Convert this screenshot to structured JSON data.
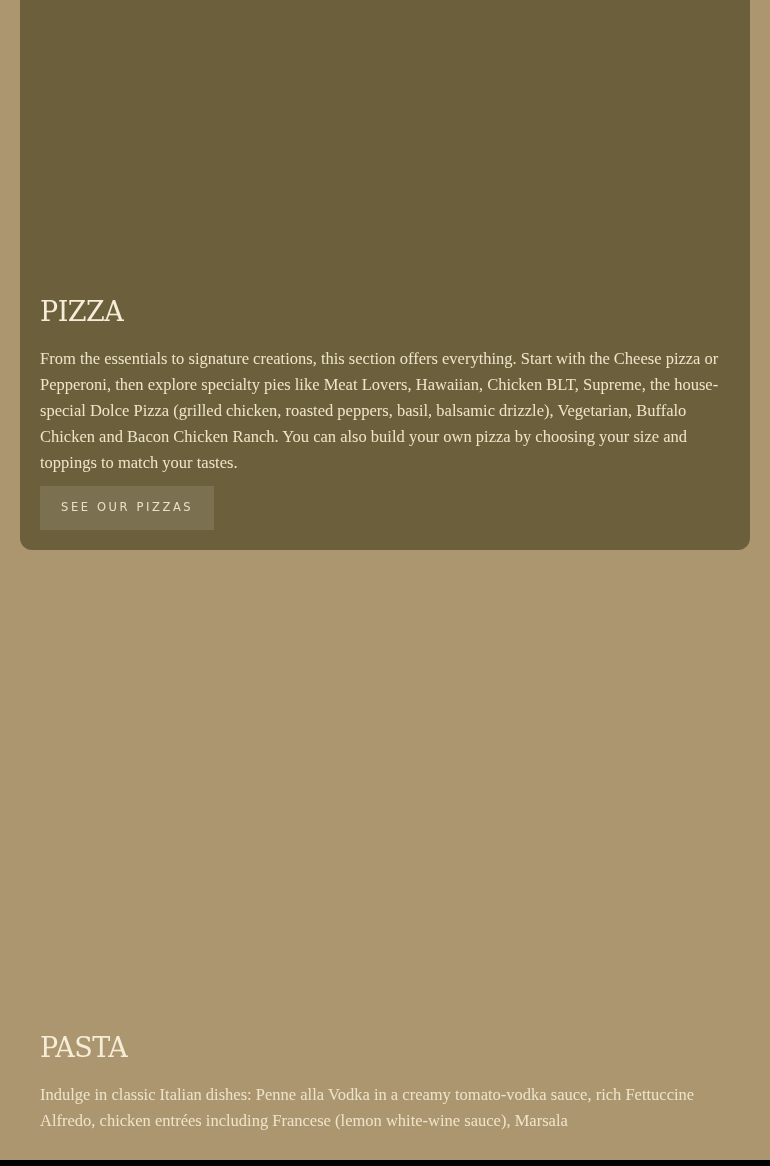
{
  "sections": [
    {
      "title": "PIZZA",
      "description": "From the essentials to signature creations, this section offers everything. Start with the Cheese pizza or Pepperoni, then explore specialty pies like Meat Lovers, Hawaiian, Chicken BLT, Supreme, the house-special Dolce Pizza (grilled chicken, roasted peppers, basil, balsamic drizzle), Vegetarian, Buffalo Chicken and Bacon Chicken Ranch. You can also build your own pizza by choosing your size and toppings to match your tastes.",
      "button": "SEE OUR PIZZAS",
      "kind": "card"
    },
    {
      "title": "PASTA",
      "description": "Indulge in classic Italian dishes: Penne alla Vodka in a creamy tomato-vodka sauce, rich Fettuccine Alfredo, chicken entrées including Francese (lemon white-wine sauce), Marsala",
      "kind": "plain"
    }
  ]
}
